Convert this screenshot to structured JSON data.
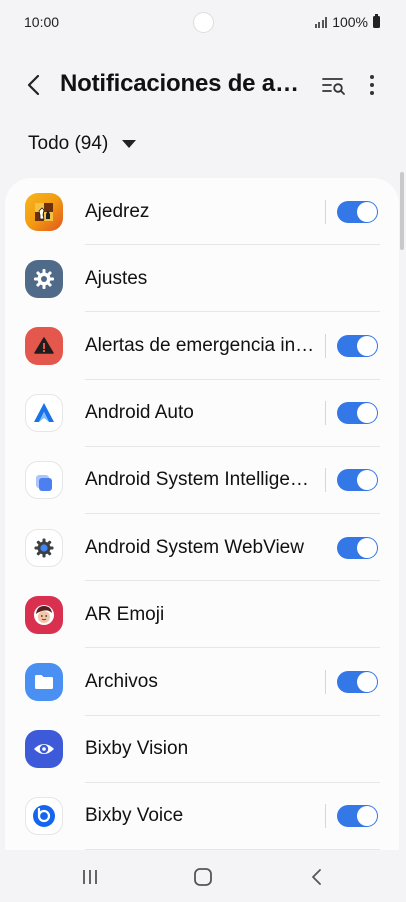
{
  "status_bar": {
    "time": "10:00",
    "battery": "100%"
  },
  "header": {
    "title": "Notificaciones de aplicaciones"
  },
  "filter": {
    "label": "Todo (94)"
  },
  "apps": [
    {
      "name": "Ajedrez",
      "toggle": true,
      "icon": "chess-app-icon"
    },
    {
      "name": "Ajustes",
      "toggle": false,
      "icon": "settings-app-icon"
    },
    {
      "name": "Alertas de emergencia inalámbricas",
      "toggle": true,
      "icon": "emergency-alerts-app-icon"
    },
    {
      "name": "Android Auto",
      "toggle": true,
      "icon": "android-auto-app-icon"
    },
    {
      "name": "Android System Intelligence",
      "toggle": true,
      "icon": "system-intelligence-app-icon"
    },
    {
      "name": "Android System WebView",
      "toggle": true,
      "icon": "webview-app-icon"
    },
    {
      "name": "AR Emoji",
      "toggle": false,
      "icon": "ar-emoji-app-icon"
    },
    {
      "name": "Archivos",
      "toggle": true,
      "icon": "files-app-icon"
    },
    {
      "name": "Bixby Vision",
      "toggle": false,
      "icon": "bixby-vision-app-icon"
    },
    {
      "name": "Bixby Voice",
      "toggle": true,
      "icon": "bixby-voice-app-icon"
    }
  ],
  "colors": {
    "accent": "#3477e6",
    "background": "#f4f4f6",
    "card": "#fcfcfc"
  }
}
